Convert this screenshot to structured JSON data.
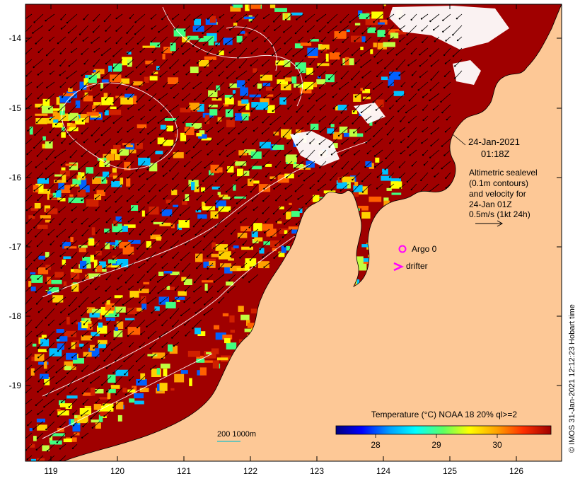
{
  "map": {
    "x_ticks": [
      "119",
      "120",
      "121",
      "122",
      "123",
      "124",
      "125",
      "126"
    ],
    "y_ticks": [
      "-14",
      "-15",
      "-16",
      "-17",
      "-18",
      "-19"
    ],
    "date": "24-Jan-2021",
    "time": "01:18Z",
    "legend_lines": [
      "Altimetric sealevel",
      "(0.1m contours)",
      "and velocity for",
      "24-Jan 01Z",
      "0.5m/s (1kt 24h)"
    ],
    "argo_label": "Argo 0",
    "drifter_label": "drifter",
    "depth_label": "200  1000m",
    "colorbar": {
      "title": "Temperature (°C) NOAA 18 20% ql>=2",
      "ticks": [
        "28",
        "29",
        "30"
      ],
      "stops": [
        "#00007f",
        "#0000ff",
        "#00a0ff",
        "#00ffff",
        "#60ff60",
        "#ffff00",
        "#ffa000",
        "#ff3000",
        "#9f0000"
      ]
    },
    "credit": "© IMOS 31-Jan-2021 12:12:23 Hobart time",
    "colors": {
      "land": "#fdc896",
      "sst_warm": "#a00000",
      "argo": "#ff00ff",
      "drifter": "#ff00ff"
    }
  }
}
